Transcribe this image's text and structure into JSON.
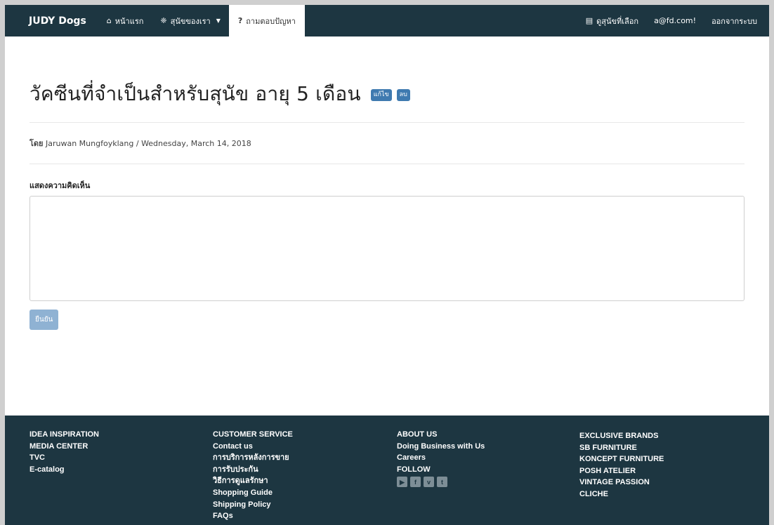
{
  "nav": {
    "brand": "JUDY Dogs",
    "items": [
      {
        "icon": "home-icon",
        "glyph": "⌂",
        "label": "หน้าแรก"
      },
      {
        "icon": "paw-icon",
        "glyph": "❈",
        "label": "สุนัขของเรา"
      },
      {
        "icon": "question-icon",
        "glyph": "?",
        "label": "ถามตอบปัญหา"
      }
    ],
    "right": [
      {
        "icon": "cart-icon",
        "glyph": "▤",
        "label": "ดูสุนัขที่เลือก"
      },
      {
        "label": "a@fd.com!"
      },
      {
        "label": "ออกจากระบบ"
      }
    ]
  },
  "post": {
    "title": "วัคซีนที่จำเป็นสำหรับสุนัข อายุ 5 เดือน",
    "edit_label": "แก้ไข",
    "delete_label": "ลบ",
    "by_label": "โดย",
    "author": "Jaruwan Mungfoyklang",
    "separator": "/",
    "date": "Wednesday, March 14, 2018"
  },
  "comment": {
    "label": "แสดงความคิดเห็น",
    "value": "",
    "submit_label": "ยืนยัน"
  },
  "footer": {
    "col1": [
      "IDEA INSPIRATION",
      "MEDIA CENTER",
      "TVC",
      "E-catalog"
    ],
    "col2": [
      "CUSTOMER SERVICE",
      "Contact us",
      "การบริการหลังการขาย",
      "การรับประกัน",
      "วิธีการดูแลรักษา",
      "Shopping Guide",
      "Shipping Policy",
      "FAQs"
    ],
    "col3": [
      "ABOUT US",
      "Doing Business with Us",
      "Careers",
      "FOLLOW"
    ],
    "social": [
      {
        "icon": "youtube-icon",
        "glyph": "▶"
      },
      {
        "icon": "facebook-icon",
        "glyph": "f"
      },
      {
        "icon": "vimeo-icon",
        "glyph": "v"
      },
      {
        "icon": "twitter-icon",
        "glyph": "t"
      }
    ],
    "col4": [
      "EXCLUSIVE BRANDS",
      "SB FURNITURE",
      "KONCEPT FURNITURE",
      "POSH ATELIER",
      "VINTAGE PASSION",
      "CLICHE"
    ]
  },
  "colors": {
    "navbar": "#1d3641",
    "accent": "#3f7ab0",
    "submit": "#8fb2d3"
  }
}
